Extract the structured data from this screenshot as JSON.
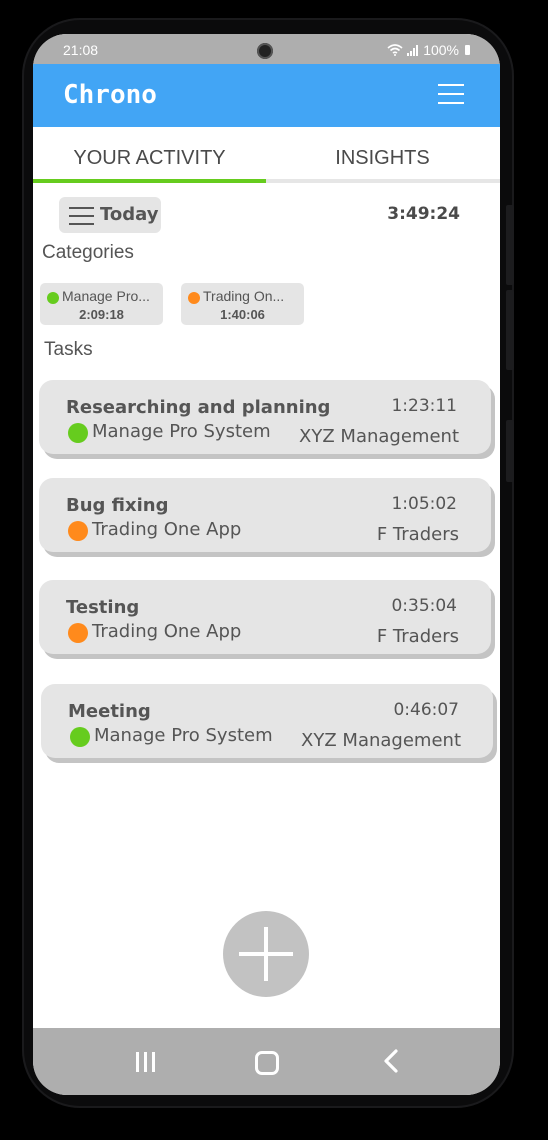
{
  "status_bar": {
    "time": "21:08",
    "battery": "100%"
  },
  "app": {
    "title": "Chrono"
  },
  "tabs": [
    {
      "label": "YOUR ACTIVITY",
      "active": true
    },
    {
      "label": "INSIGHTS",
      "active": false
    }
  ],
  "filter": {
    "label": "Today"
  },
  "total_time": "3:49:24",
  "categories": {
    "heading": "Categories",
    "items": [
      {
        "name": "Manage Pro...",
        "time": "2:09:18",
        "color": "#66cc1e"
      },
      {
        "name": "Trading On...",
        "time": "1:40:06",
        "color": "#ff8a1c"
      }
    ]
  },
  "tasks": {
    "heading": "Tasks",
    "items": [
      {
        "title": "Researching and planning",
        "category": "Manage Pro System",
        "time": "1:23:11",
        "client": "XYZ Management",
        "color": "#66cc1e"
      },
      {
        "title": "Bug fixing",
        "category": "Trading One App",
        "time": "1:05:02",
        "client": "F Traders",
        "color": "#ff8a1c"
      },
      {
        "title": "Testing",
        "category": "Trading One App",
        "time": "0:35:04",
        "client": "F Traders",
        "color": "#ff8a1c"
      },
      {
        "title": "Meeting",
        "category": "Manage Pro System",
        "time": "0:46:07",
        "client": "XYZ Management",
        "color": "#66cc1e"
      }
    ]
  },
  "colors": {
    "app_bar": "#42a5f5",
    "tab_indicator": "#66cc1e",
    "card": "#e5e5e5"
  },
  "icons": {
    "menu": "hamburger-menu-icon",
    "filter": "list-icon",
    "fab": "plus-icon",
    "nav": [
      "recent-apps-icon",
      "home-icon",
      "back-icon"
    ]
  }
}
